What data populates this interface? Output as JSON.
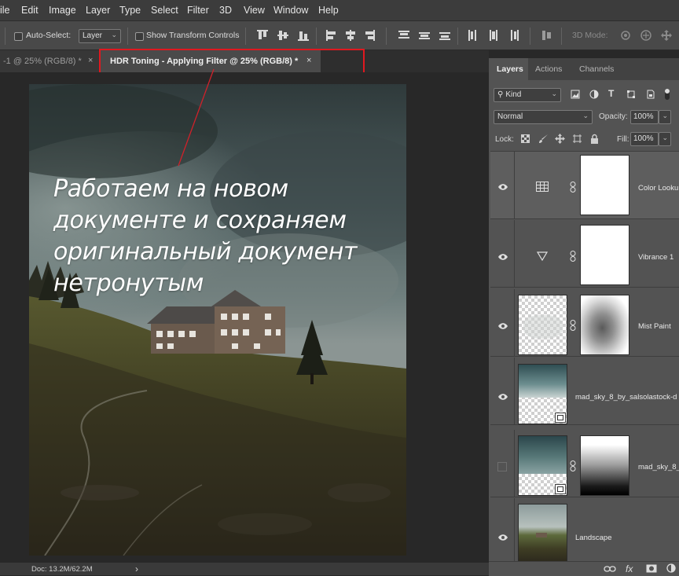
{
  "menu": [
    "ile",
    "Edit",
    "Image",
    "Layer",
    "Type",
    "Select",
    "Filter",
    "3D",
    "View",
    "Window",
    "Help"
  ],
  "options": {
    "auto_select_label": "Auto-Select:",
    "auto_select_value": "Layer",
    "show_transform_label": "Show Transform Controls",
    "mode_3d_label": "3D Mode:"
  },
  "tabs": {
    "inactive_label": "-1 @ 25% (RGB/8) *",
    "active_label": "HDR Toning - Applying Filter @ 25% (RGB/8) *",
    "close_glyph": "×"
  },
  "canvas": {
    "overlay_lines": [
      "Работаем на новом",
      "документе и сохраняем",
      "оригинальный документ",
      "нетронутым"
    ]
  },
  "status": {
    "doc_info": "Doc: 13.2M/62.2M",
    "arrow": "›"
  },
  "panel": {
    "tabs": [
      "Layers",
      "Actions",
      "Channels"
    ],
    "filter_kind": "Kind",
    "blend_mode": "Normal",
    "opacity_label": "Opacity:",
    "opacity_value": "100%",
    "lock_label": "Lock:",
    "fill_label": "Fill:",
    "fill_value": "100%",
    "layers": [
      {
        "name": "Color Looku",
        "visible": true
      },
      {
        "name": "Vibrance 1",
        "visible": true
      },
      {
        "name": "Mist Paint",
        "visible": true
      },
      {
        "name": "mad_sky_8_by_salsolastock-d",
        "visible": true
      },
      {
        "name": "mad_sky_8_",
        "visible": false
      },
      {
        "name": "Landscape",
        "visible": true
      }
    ],
    "footer_fx": "fx"
  },
  "colors": {
    "highlight_box": "#e0181f",
    "annotation_line": "#d0212a",
    "active_tab_bg": "#4a4a4a"
  }
}
